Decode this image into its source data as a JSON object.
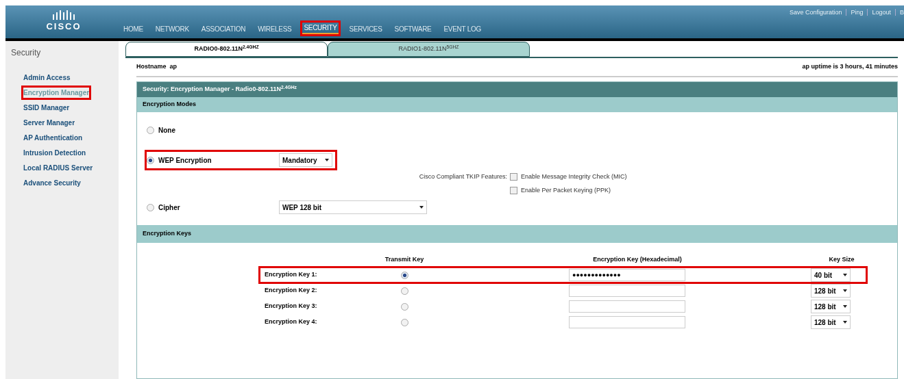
{
  "header": {
    "logo": "CISCO",
    "nav": [
      {
        "label": "HOME",
        "selected": false,
        "highlighted": false
      },
      {
        "label": "NETWORK",
        "selected": false,
        "highlighted": false
      },
      {
        "label": "ASSOCIATION",
        "selected": false,
        "highlighted": false
      },
      {
        "label": "WIRELESS",
        "selected": false,
        "highlighted": false
      },
      {
        "label": "SECURITY",
        "selected": true,
        "highlighted": true
      },
      {
        "label": "SERVICES",
        "selected": false,
        "highlighted": false
      },
      {
        "label": "SOFTWARE",
        "selected": false,
        "highlighted": false
      },
      {
        "label": "EVENT LOG",
        "selected": false,
        "highlighted": false
      }
    ],
    "links": [
      "Save Configuration",
      "Ping",
      "Logout",
      "B"
    ]
  },
  "sidebar": {
    "title": "Security",
    "items": [
      {
        "label": "Admin Access",
        "selected": false,
        "highlighted": false
      },
      {
        "label": "Encryption Manager",
        "selected": true,
        "highlighted": true
      },
      {
        "label": "SSID Manager",
        "selected": false,
        "highlighted": false
      },
      {
        "label": "Server Manager",
        "selected": false,
        "highlighted": false
      },
      {
        "label": "AP Authentication",
        "selected": false,
        "highlighted": false
      },
      {
        "label": "Intrusion Detection",
        "selected": false,
        "highlighted": false
      },
      {
        "label": "Local RADIUS Server",
        "selected": false,
        "highlighted": false
      },
      {
        "label": "Advance Security",
        "selected": false,
        "highlighted": false
      }
    ]
  },
  "tabs": [
    {
      "label": "RADIO0-802.11N$^{2.4GHZ}$",
      "selected": true
    },
    {
      "label": "RADIO1-802.11N$^{5GHZ}$",
      "selected": false
    }
  ],
  "hostname": "Hostname  ap",
  "uptime": "ap uptime is 3 hours, 41 minutes",
  "panel": {
    "title": "Security: Encryption Manager - Radio0-802.11N$^{2.4GHz}$",
    "modes_header": "Encryption Modes",
    "modes": [
      {
        "kind": "plain",
        "label": "None",
        "selected": false,
        "highlighted": false
      },
      {
        "kind": "select",
        "label": "WEP Encryption",
        "selected": true,
        "highlighted": true,
        "value": "Mandatory"
      },
      {
        "kind": "select-wide",
        "label": "Cipher",
        "selected": false,
        "highlighted": false,
        "value": "WEP 128 bit"
      }
    ],
    "tkip_label": "Cisco Compliant TKIP Features:",
    "tkip_options": [
      {
        "label": "Enable Message Integrity Check (MIC)",
        "checked": false
      },
      {
        "label": "Enable Per Packet Keying (PPK)",
        "checked": false
      }
    ],
    "keys_header": "Encryption Keys",
    "columns": [
      "Transmit Key",
      "Encryption Key (Hexadecimal)",
      "Key Size"
    ],
    "keys": [
      {
        "label": "Encryption Key 1:",
        "selected": true,
        "highlighted": true,
        "value": "●●●●●●●●●●●●●",
        "size": "40 bit"
      },
      {
        "label": "Encryption Key 2:",
        "selected": false,
        "highlighted": false,
        "size": "128 bit"
      },
      {
        "label": "Encryption Key 3:",
        "selected": false,
        "highlighted": false,
        "size": "128 bit"
      },
      {
        "label": "Encryption Key 4:",
        "selected": false,
        "highlighted": false,
        "size": "128 bit"
      }
    ]
  }
}
